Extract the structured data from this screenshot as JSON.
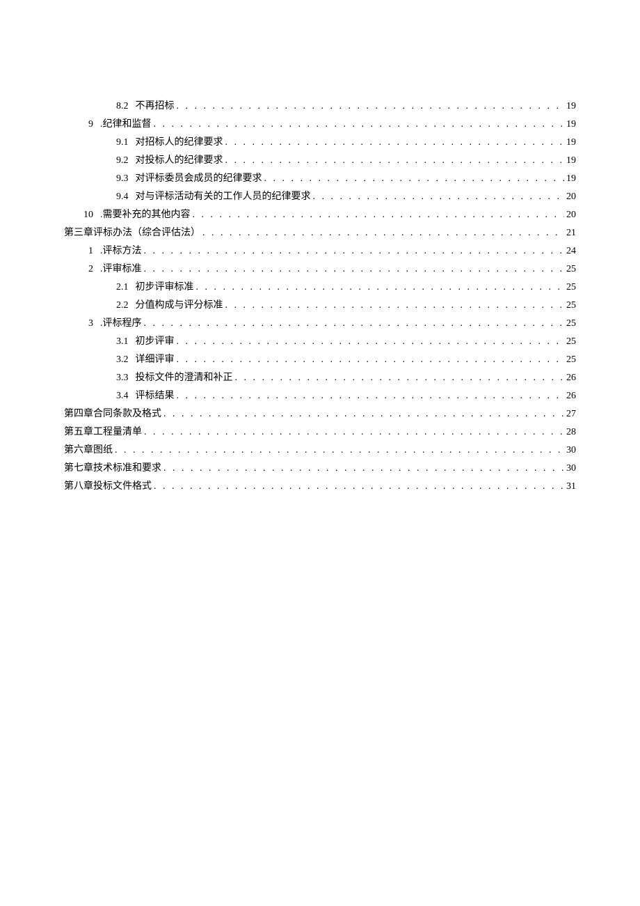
{
  "toc": {
    "entries": [
      {
        "level": "level-2",
        "number": "8.2",
        "text": "不再招标",
        "page": "19"
      },
      {
        "level": "level-1",
        "number": "9",
        "text": ".纪律和监督",
        "page": "19"
      },
      {
        "level": "level-2",
        "number": "9.1",
        "text": "对招标人的纪律要求",
        "page": "19"
      },
      {
        "level": "level-2",
        "number": "9.2",
        "text": "对投标人的纪律要求",
        "page": "19"
      },
      {
        "level": "level-2",
        "number": "9.3",
        "text": "对评标委员会成员的纪律要求",
        "page": "19"
      },
      {
        "level": "level-2",
        "number": "9.4",
        "text": "对与评标活动有关的工作人员的纪律要求",
        "page": "20"
      },
      {
        "level": "level-1-wide",
        "number": "10",
        "text": ".需要补充的其他内容",
        "page": "20"
      },
      {
        "level": "level-0",
        "number": "",
        "text": "第三章评标办法（综合评估法）",
        "page": "21"
      },
      {
        "level": "level-1",
        "number": "1",
        "text": ".评标方法",
        "page": "24"
      },
      {
        "level": "level-1",
        "number": "2",
        "text": ".评审标准",
        "page": "25"
      },
      {
        "level": "level-2",
        "number": "2.1",
        "text": "初步评审标准",
        "page": "25"
      },
      {
        "level": "level-2",
        "number": "2.2",
        "text": "分值构成与评分标准",
        "page": "25"
      },
      {
        "level": "level-1",
        "number": "3",
        "text": ".评标程序",
        "page": "25"
      },
      {
        "level": "level-2",
        "number": "3.1",
        "text": "初步评审",
        "page": "25"
      },
      {
        "level": "level-2",
        "number": "3.2",
        "text": "详细评审",
        "page": "25"
      },
      {
        "level": "level-2",
        "number": "3.3",
        "text": "投标文件的澄清和补正",
        "page": "26"
      },
      {
        "level": "level-2",
        "number": "3.4",
        "text": "评标结果",
        "page": "26"
      },
      {
        "level": "level-0",
        "number": "",
        "text": "第四章合同条款及格式",
        "page": "27"
      },
      {
        "level": "level-0",
        "number": "",
        "text": "第五章工程量清单",
        "page": "28"
      },
      {
        "level": "level-0",
        "number": "",
        "text": "第六章图纸",
        "page": "30"
      },
      {
        "level": "level-0",
        "number": "",
        "text": "第七章技术标准和要求",
        "page": "30"
      },
      {
        "level": "level-0",
        "number": "",
        "text": "第八章投标文件格式",
        "page": "31"
      }
    ]
  }
}
